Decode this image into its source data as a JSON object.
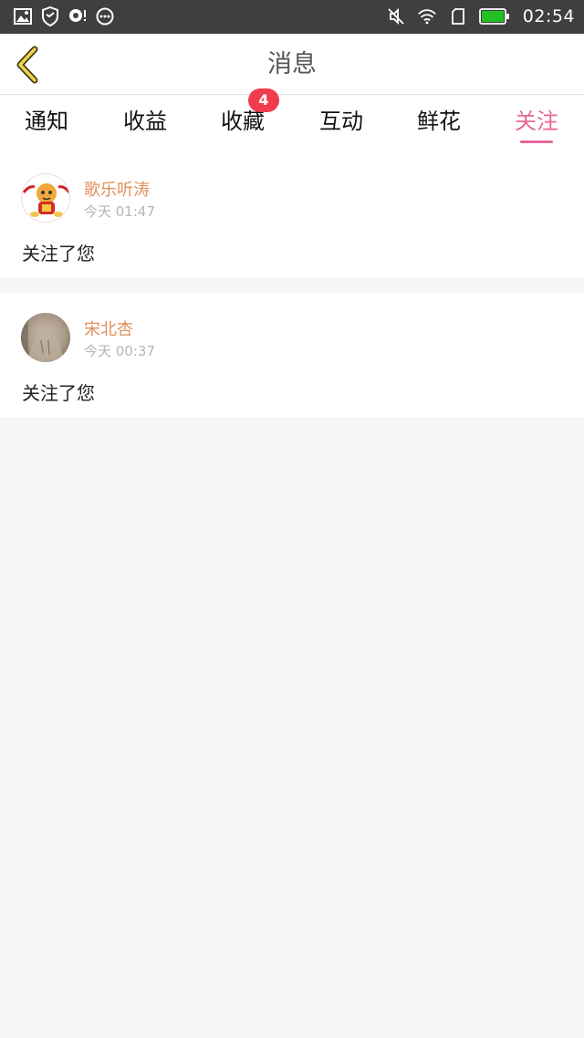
{
  "status_bar": {
    "time": "02:54",
    "battery_color": "#22c022"
  },
  "header": {
    "title": "消息"
  },
  "tabs": [
    {
      "label": "通知"
    },
    {
      "label": "收益"
    },
    {
      "label": "收藏",
      "badge": "4"
    },
    {
      "label": "互动"
    },
    {
      "label": "鲜花"
    },
    {
      "label": "关注",
      "active": true
    }
  ],
  "notifications": [
    {
      "username": "歌乐听涛",
      "time": "今天 01:47",
      "message": "关注了您"
    },
    {
      "username": "宋北杏",
      "time": "今天 00:37",
      "message": "关注了您"
    }
  ],
  "colors": {
    "accent": "#e8669a",
    "username": "#e0905a",
    "badge": "#f03c4c"
  }
}
